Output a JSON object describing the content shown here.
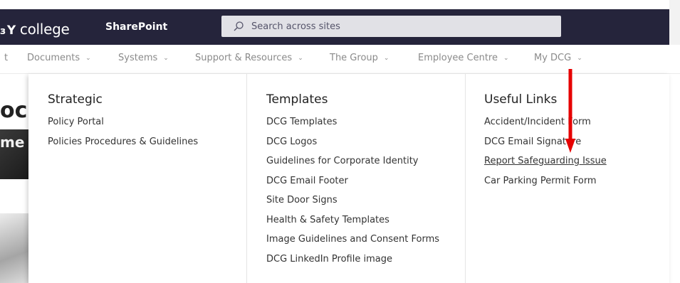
{
  "header": {
    "logo_prefix": "з",
    "logo_y": "Y",
    "logo_text": " college",
    "site_name": "SharePoint",
    "search_placeholder": "Search across sites"
  },
  "nav": {
    "items": [
      {
        "label": "t"
      },
      {
        "label": "Documents"
      },
      {
        "label": "Systems"
      },
      {
        "label": "Support & Resources"
      },
      {
        "label": "The Group"
      },
      {
        "label": "Employee Centre"
      },
      {
        "label": "My DCG"
      }
    ]
  },
  "background": {
    "heading_fragment": "oc",
    "image_text": "me"
  },
  "menu": {
    "columns": [
      {
        "title": "Strategic",
        "links": [
          "Policy Portal",
          "Policies Procedures & Guidelines"
        ]
      },
      {
        "title": "Templates",
        "links": [
          "DCG Templates",
          "DCG Logos",
          "Guidelines for Corporate Identity",
          "DCG Email Footer",
          "Site Door Signs",
          "Health & Safety Templates",
          "Image Guidelines and Consent Forms",
          "DCG LinkedIn Profile image"
        ]
      },
      {
        "title": "Useful Links",
        "links": [
          "Accident/Incident Form",
          "DCG Email Signature",
          "Report Safeguarding Issue",
          "Car Parking Permit Form"
        ]
      }
    ]
  },
  "colors": {
    "topbar": "#25243b",
    "annotation_arrow": "#e60000"
  }
}
